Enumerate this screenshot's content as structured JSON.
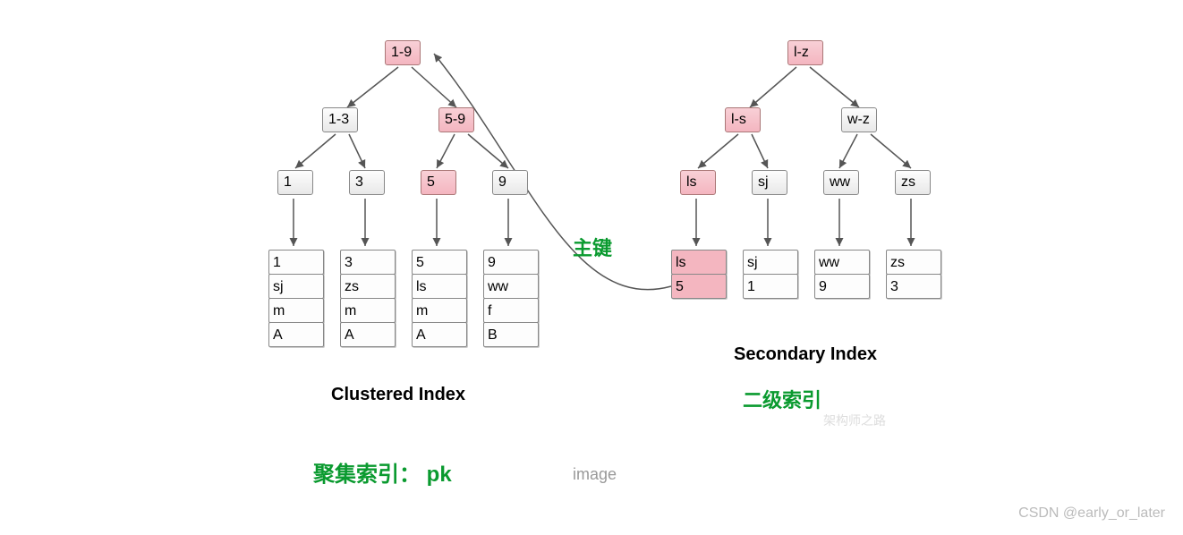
{
  "clustered": {
    "root": "1-9",
    "level1_left": "1-3",
    "level1_right": "5-9",
    "level2": [
      "1",
      "3",
      "5",
      "9"
    ],
    "leaves": [
      [
        "1",
        "sj",
        "m",
        "A"
      ],
      [
        "3",
        "zs",
        "m",
        "A"
      ],
      [
        "5",
        "ls",
        "m",
        "A"
      ],
      [
        "9",
        "ww",
        "f",
        "B"
      ]
    ],
    "title": "Clustered Index",
    "green_label": "聚集索引： pk"
  },
  "secondary": {
    "root": "l-z",
    "level1_left": "l-s",
    "level1_right": "w-z",
    "level2": [
      "ls",
      "sj",
      "ww",
      "zs"
    ],
    "leaves": [
      [
        "ls",
        "5"
      ],
      [
        "sj",
        "1"
      ],
      [
        "ww",
        "9"
      ],
      [
        "zs",
        "3"
      ]
    ],
    "title": "Secondary Index",
    "green_label": "二级索引"
  },
  "pk_label": "主键",
  "image_caption": "image",
  "attribution": "CSDN @early_or_later",
  "faint_watermark": "架构师之路",
  "chart_data": {
    "type": "table",
    "description": "B+Tree index structure comparison",
    "clustered_index": {
      "tree": {
        "root": "1-9",
        "children": [
          {
            "key": "1-3",
            "children": [
              {
                "key": "1",
                "row": {
                  "id": 1,
                  "name": "sj",
                  "sex": "m",
                  "flag": "A"
                }
              },
              {
                "key": "3",
                "row": {
                  "id": 3,
                  "name": "zs",
                  "sex": "m",
                  "flag": "A"
                }
              }
            ]
          },
          {
            "key": "5-9",
            "children": [
              {
                "key": "5",
                "row": {
                  "id": 5,
                  "name": "ls",
                  "sex": "m",
                  "flag": "A"
                }
              },
              {
                "key": "9",
                "row": {
                  "id": 9,
                  "name": "ww",
                  "sex": "f",
                  "flag": "B"
                }
              }
            ]
          }
        ]
      },
      "highlighted_path": [
        "1-9",
        "5-9",
        "5"
      ]
    },
    "secondary_index": {
      "tree": {
        "root": "l-z",
        "children": [
          {
            "key": "l-s",
            "children": [
              {
                "key": "ls",
                "pk": 5
              },
              {
                "key": "sj",
                "pk": 1
              }
            ]
          },
          {
            "key": "w-z",
            "children": [
              {
                "key": "ww",
                "pk": 9
              },
              {
                "key": "zs",
                "pk": 3
              }
            ]
          }
        ]
      },
      "highlighted_path": [
        "l-z",
        "l-s",
        "ls"
      ],
      "lookup_result": {
        "key": "ls",
        "pk": 5,
        "points_to_clustered_root": true
      }
    }
  }
}
